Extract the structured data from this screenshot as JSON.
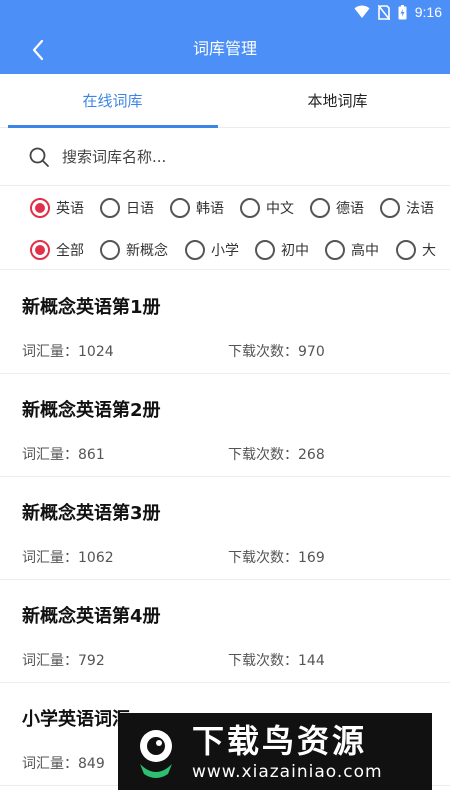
{
  "status_bar": {
    "time": "9:16"
  },
  "app_bar": {
    "title": "词库管理"
  },
  "tabs": [
    {
      "label": "在线词库",
      "active": true
    },
    {
      "label": "本地词库",
      "active": false
    }
  ],
  "search": {
    "placeholder": "搜索词库名称..."
  },
  "language_filters": [
    {
      "label": "英语",
      "checked": true
    },
    {
      "label": "日语",
      "checked": false
    },
    {
      "label": "韩语",
      "checked": false
    },
    {
      "label": "中文",
      "checked": false
    },
    {
      "label": "德语",
      "checked": false
    },
    {
      "label": "法语",
      "checked": false
    }
  ],
  "level_filters": [
    {
      "label": "全部",
      "checked": true
    },
    {
      "label": "新概念",
      "checked": false
    },
    {
      "label": "小学",
      "checked": false
    },
    {
      "label": "初中",
      "checked": false
    },
    {
      "label": "高中",
      "checked": false
    },
    {
      "label": "大",
      "checked": false
    }
  ],
  "labels": {
    "vocab_prefix": "词汇量：",
    "downloads_prefix": "下载次数："
  },
  "wordbanks": [
    {
      "name": "新概念英语第1册",
      "vocab": "词汇量：1024",
      "downloads": "下载次数：970"
    },
    {
      "name": "新概念英语第2册",
      "vocab": "词汇量：861",
      "downloads": "下载次数：268"
    },
    {
      "name": "新概念英语第3册",
      "vocab": "词汇量：1062",
      "downloads": "下载次数：169"
    },
    {
      "name": "新概念英语第4册",
      "vocab": "词汇量：792",
      "downloads": "下载次数：144"
    },
    {
      "name": "小学英语词汇",
      "vocab": "词汇量：849",
      "downloads": ""
    }
  ],
  "watermark": {
    "main": "下载鸟资源",
    "url": "www.xiazainiao.com"
  },
  "colors": {
    "primary": "#4c8ff6",
    "tab_active": "#3d86e6",
    "radio_checked": "#e0314b"
  }
}
